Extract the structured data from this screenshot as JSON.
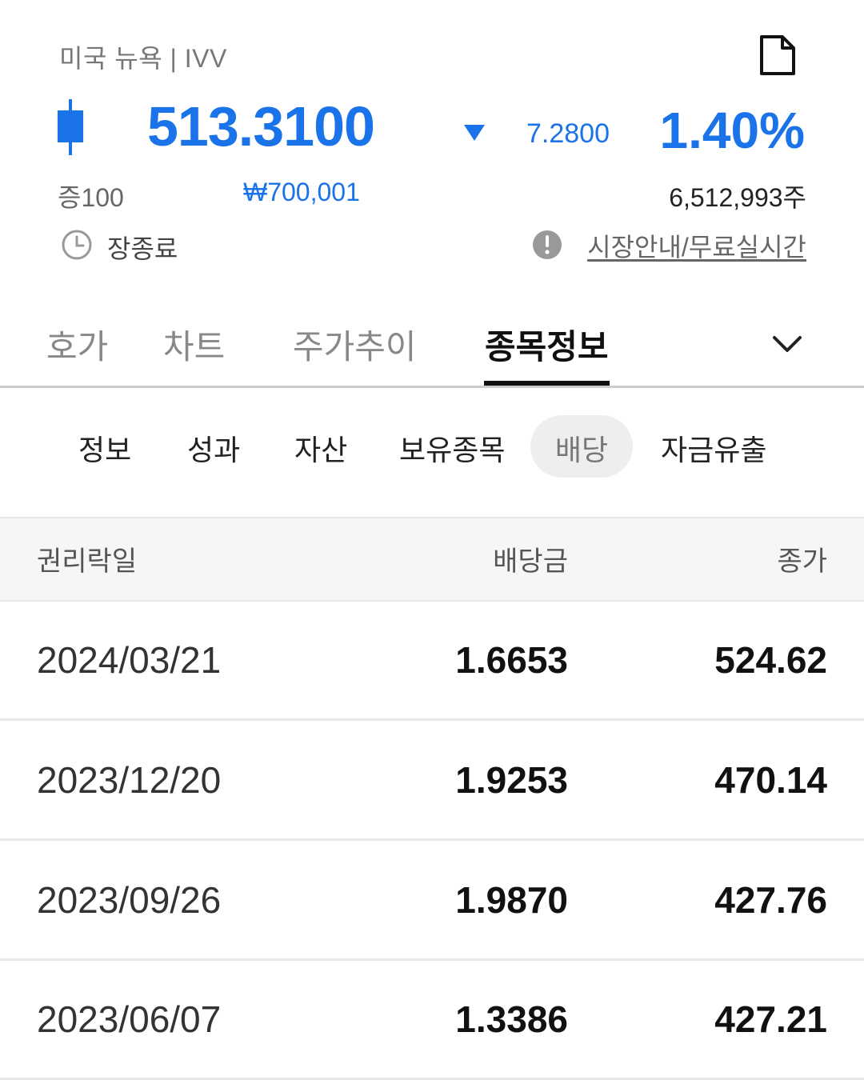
{
  "header": {
    "market_label": "미국 뉴욕 | IVV",
    "price": "513.3100",
    "change": "7.2800",
    "change_pct": "1.40%",
    "lot": "증100",
    "krw_price": "₩700,001",
    "volume": "6,512,993주",
    "status": "장종료",
    "market_link": "시장안내/무료실시간",
    "accent_color": "#1a73e8",
    "icons": {
      "document": "document-icon",
      "candle": "candlestick-icon",
      "direction": "down-triangle-icon",
      "clock": "clock-icon",
      "info": "info-icon"
    }
  },
  "main_tabs": [
    {
      "label": "호가"
    },
    {
      "label": "차트"
    },
    {
      "label": "주가추이"
    },
    {
      "label": "종목정보",
      "active": true
    }
  ],
  "sub_tabs": [
    {
      "label": "정보"
    },
    {
      "label": "성과"
    },
    {
      "label": "자산"
    },
    {
      "label": "보유종목"
    },
    {
      "label": "배당",
      "active": true
    },
    {
      "label": "자금유출"
    }
  ],
  "dividend_table": {
    "columns": [
      "권리락일",
      "배당금",
      "종가"
    ],
    "rows": [
      {
        "date": "2024/03/21",
        "dividend": "1.6653",
        "close": "524.62"
      },
      {
        "date": "2023/12/20",
        "dividend": "1.9253",
        "close": "470.14"
      },
      {
        "date": "2023/09/26",
        "dividend": "1.9870",
        "close": "427.76"
      },
      {
        "date": "2023/06/07",
        "dividend": "1.3386",
        "close": "427.21"
      }
    ]
  }
}
